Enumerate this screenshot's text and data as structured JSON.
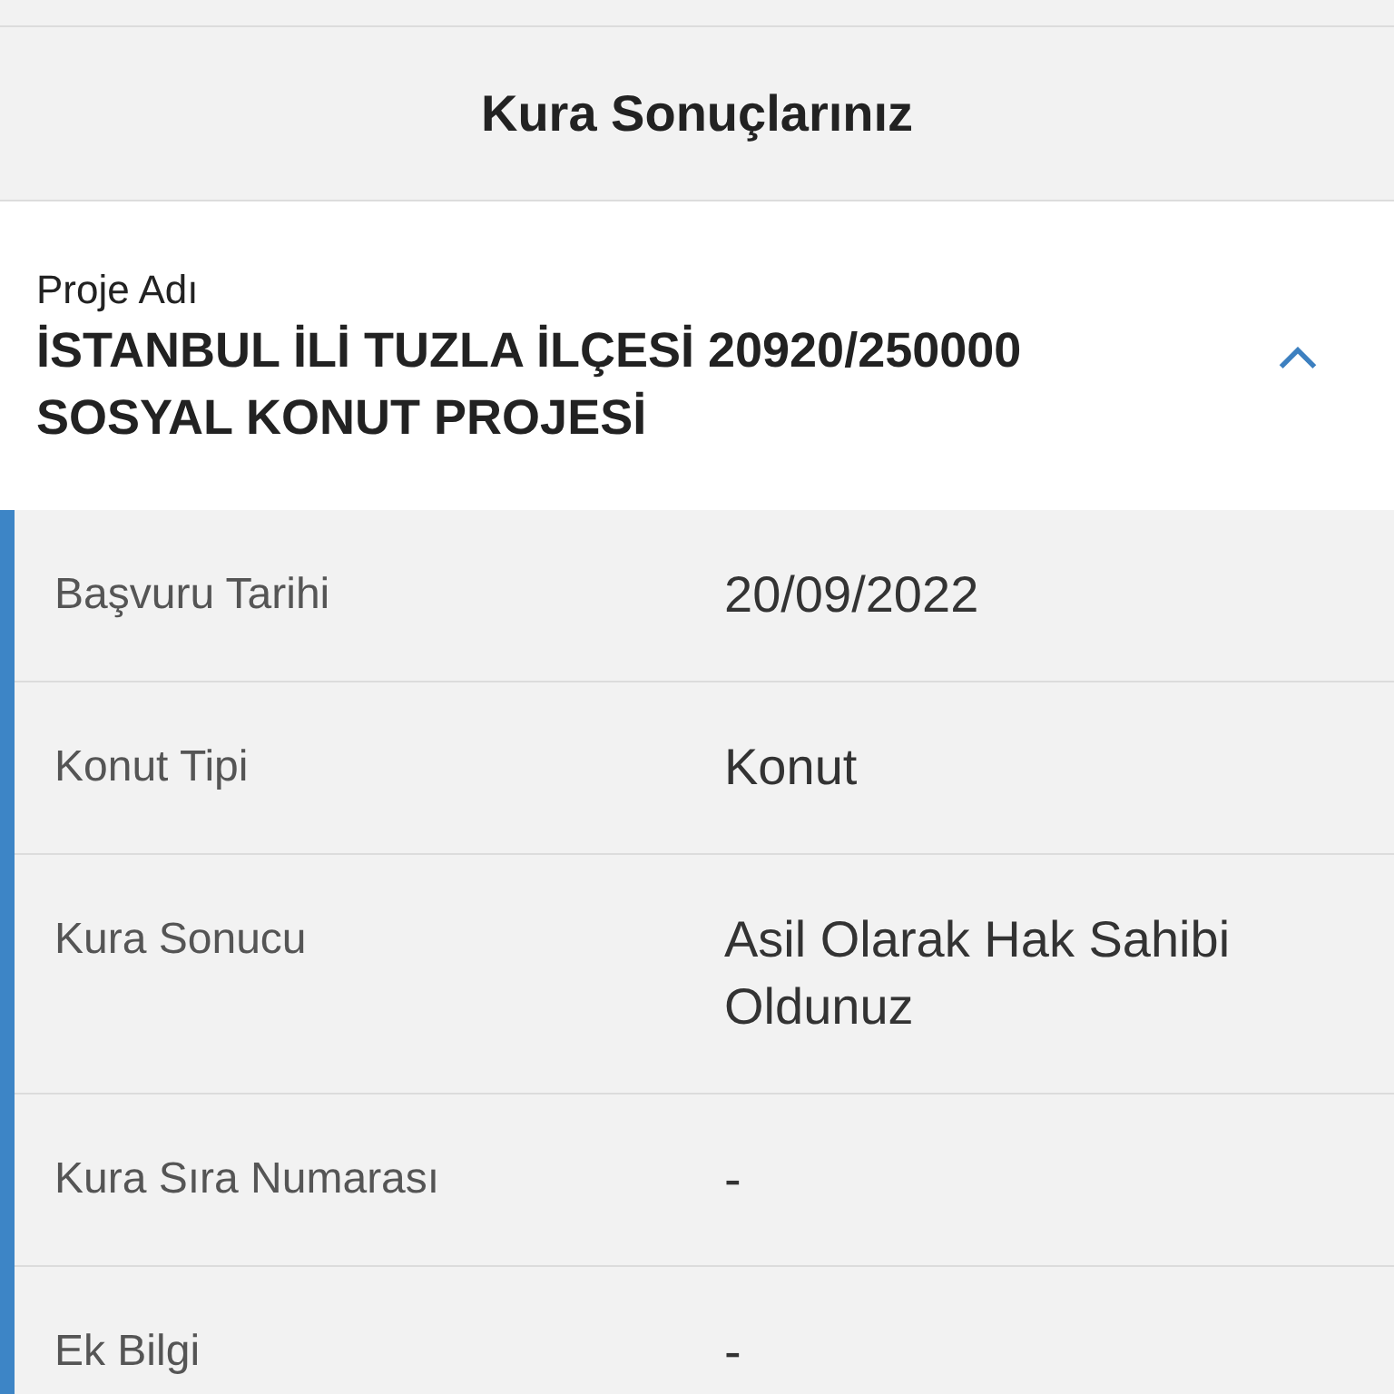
{
  "header": {
    "title": "Kura Sonuçlarınız"
  },
  "project": {
    "label": "Proje Adı",
    "name": "İSTANBUL İLİ TUZLA İLÇESİ 20920/250000 SOSYAL KONUT PROJESİ",
    "expanded": true
  },
  "details": [
    {
      "label": "Başvuru Tarihi",
      "value": "20/09/2022"
    },
    {
      "label": "Konut Tipi",
      "value": "Konut"
    },
    {
      "label": "Kura Sonucu",
      "value": "Asil Olarak Hak Sahibi Oldunuz"
    },
    {
      "label": "Kura Sıra Numarası",
      "value": "-"
    },
    {
      "label": "Ek Bilgi",
      "value": "-"
    }
  ]
}
